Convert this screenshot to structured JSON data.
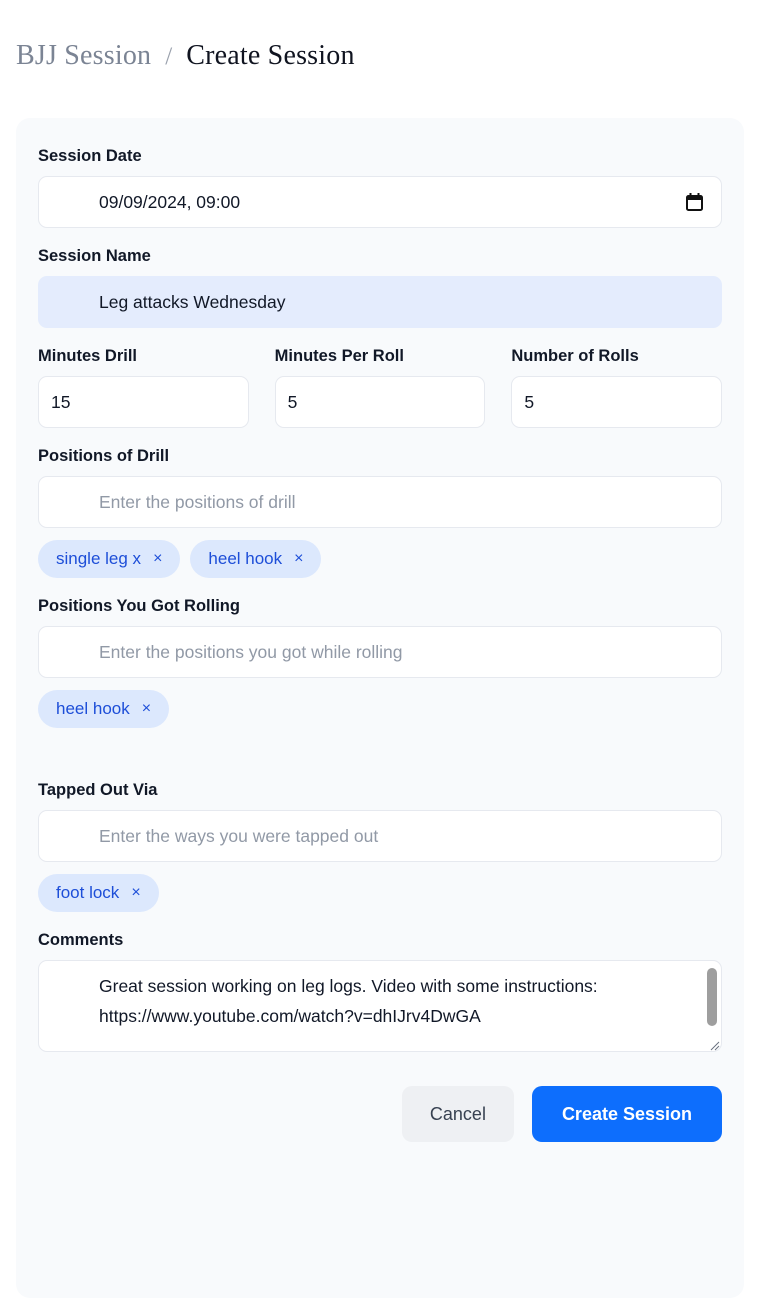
{
  "breadcrumb": {
    "root": "BJJ Session",
    "separator": "/",
    "current": "Create Session"
  },
  "colors": {
    "primary": "#0d6efd",
    "chip_bg": "#dce8fd",
    "chip_text": "#1d4ed8",
    "card_bg": "#f8fafc",
    "autofill_bg": "#e4ecfd",
    "page_bg": "#ffffff"
  },
  "form": {
    "session_date": {
      "label": "Session Date",
      "value": "09/09/2024, 09:00",
      "icon": "calendar-icon"
    },
    "session_name": {
      "label": "Session Name",
      "value": "Leg attacks Wednesday"
    },
    "minutes_drill": {
      "label": "Minutes Drill",
      "value": "15"
    },
    "minutes_per_roll": {
      "label": "Minutes Per Roll",
      "value": "5"
    },
    "number_of_rolls": {
      "label": "Number of Rolls",
      "value": "5"
    },
    "positions_of_drill": {
      "label": "Positions of Drill",
      "placeholder": "Enter the positions of drill",
      "value": "",
      "tags": [
        {
          "label": "single leg x",
          "remove": "×"
        },
        {
          "label": "heel hook",
          "remove": "×"
        }
      ]
    },
    "positions_rolling": {
      "label": "Positions You Got Rolling",
      "placeholder": "Enter the positions you got while rolling",
      "value": "",
      "tags": [
        {
          "label": "heel hook",
          "remove": "×"
        }
      ]
    },
    "tapped_out_via": {
      "label": "Tapped Out Via",
      "placeholder": "Enter the ways you were tapped out",
      "value": "",
      "tags": [
        {
          "label": "foot lock",
          "remove": "×"
        }
      ]
    },
    "comments": {
      "label": "Comments",
      "value": "Great session working on leg logs. Video with some instructions: https://www.youtube.com/watch?v=dhIJrv4DwGA"
    }
  },
  "actions": {
    "cancel_label": "Cancel",
    "submit_label": "Create Session"
  }
}
